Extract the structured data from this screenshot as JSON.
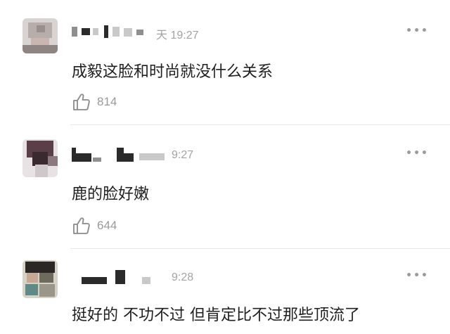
{
  "comments": [
    {
      "time": "天 19:27",
      "text": "成毅这脸和时尚就没什么关系",
      "likes": "814",
      "more": "•••"
    },
    {
      "time": "9:27",
      "text": "鹿的脸好嫩",
      "likes": "644",
      "more": "•••"
    },
    {
      "time": "9:28",
      "text": "挺好的 不功不过 但肯定比不过那些顶流了",
      "more": "•••"
    }
  ],
  "icons": {
    "like": "thumbs-up-icon",
    "more": "more-options-icon"
  }
}
